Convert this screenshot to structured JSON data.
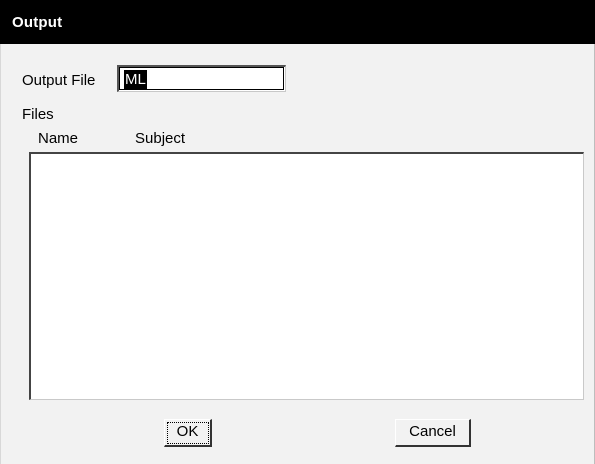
{
  "window": {
    "title": "Output"
  },
  "form": {
    "output_file_label": "Output File",
    "output_file_value": "ML",
    "files_label": "Files",
    "columns": [
      "Name",
      "Subject"
    ],
    "files": []
  },
  "buttons": {
    "ok_label": "OK",
    "cancel_label": "Cancel"
  }
}
